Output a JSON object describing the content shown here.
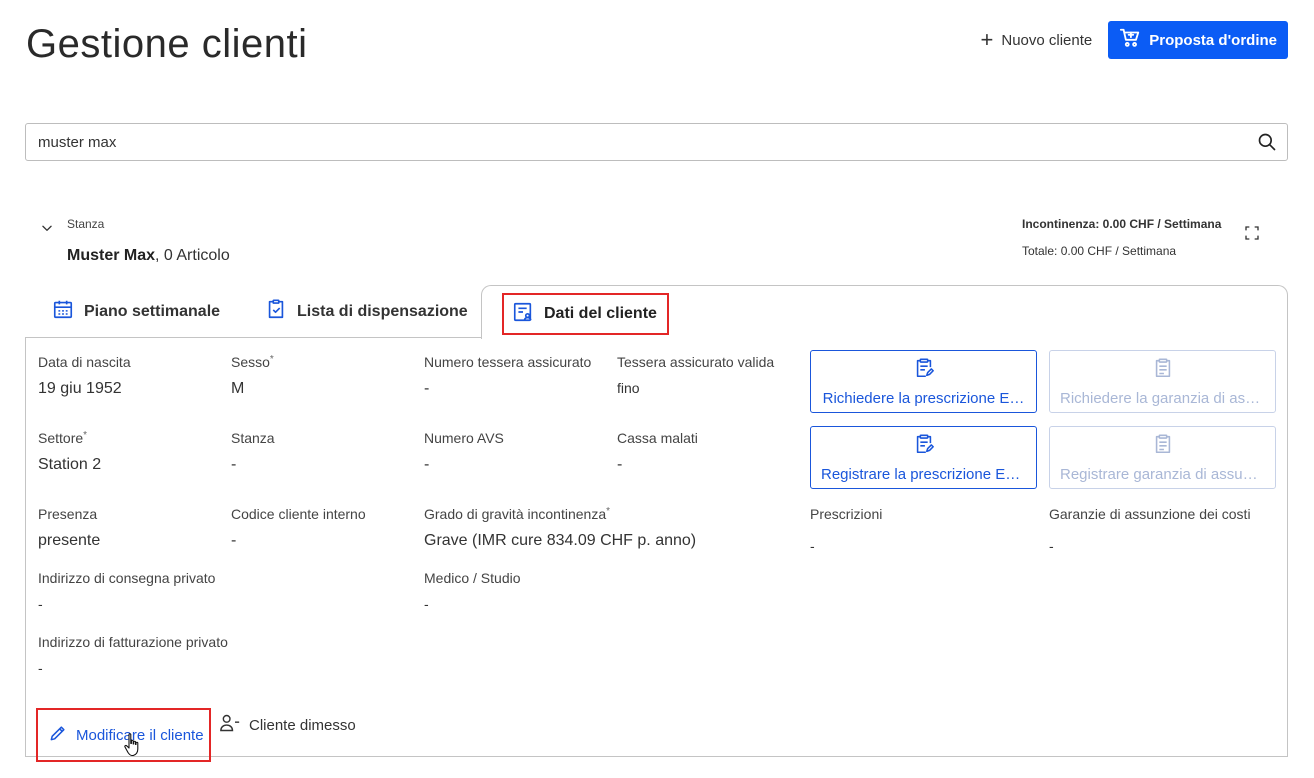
{
  "header": {
    "title": "Gestione clienti",
    "new_client_label": "Nuovo cliente",
    "order_proposal_label": "Proposta d'ordine"
  },
  "search": {
    "value": "muster max"
  },
  "client": {
    "room_label": "Stanza",
    "name": "Muster Max",
    "articles": ", 0 Articolo",
    "incontinence_total": "Incontinenza: 0.00 CHF / Settimana",
    "total": "Totale: 0.00 CHF / Settimana"
  },
  "tabs": {
    "plan": "Piano settimanale",
    "list": "Lista di dispensazione",
    "data": "Dati del cliente"
  },
  "fields": {
    "birth_label": "Data di nascita",
    "birth_value": "19 giu 1952",
    "sex_label": "Sesso",
    "sex_value": "M",
    "insurance_card_label": "Numero tessera assicurato",
    "insurance_card_value": "-",
    "insurance_valid_label": "Tessera assicurato valida",
    "insurance_valid_value": "fino",
    "sector_label": "Settore",
    "sector_value": "Station 2",
    "room_label": "Stanza",
    "room_value": "-",
    "avs_label": "Numero AVS",
    "avs_value": "-",
    "health_ins_label": "Cassa malati",
    "health_ins_value": "-",
    "presence_label": "Presenza",
    "presence_value": "presente",
    "internal_code_label": "Codice cliente interno",
    "internal_code_value": "-",
    "severity_label": "Grado di gravità incontinenza",
    "severity_value": "Grave (IMR cure 834.09 CHF p. anno)",
    "prescriptions_label": "Prescrizioni",
    "prescriptions_value": "-",
    "guarantees_label": "Garanzie di assunzione dei costi",
    "guarantees_value": "-",
    "delivery_label": "Indirizzo di consegna privato",
    "delivery_value": "-",
    "doctor_label": "Medico / Studio",
    "doctor_value": "-",
    "billing_label": "Indirizzo di fatturazione privato",
    "billing_value": "-"
  },
  "actions": {
    "request_prescription": "Richiedere la prescrizione E…",
    "request_guarantee": "Richiedere la garanzia di ass…",
    "register_prescription": "Registrare la prescrizione EM…",
    "register_guarantee": "Registrare garanzia di assun…"
  },
  "footer": {
    "edit_label": "Modificare il cliente",
    "discharge_label": "Cliente dimesso"
  },
  "colors": {
    "primary": "#0b5cf5",
    "link": "#1a56db",
    "highlight": "#e32626",
    "disabled": "#a9b7d6"
  }
}
